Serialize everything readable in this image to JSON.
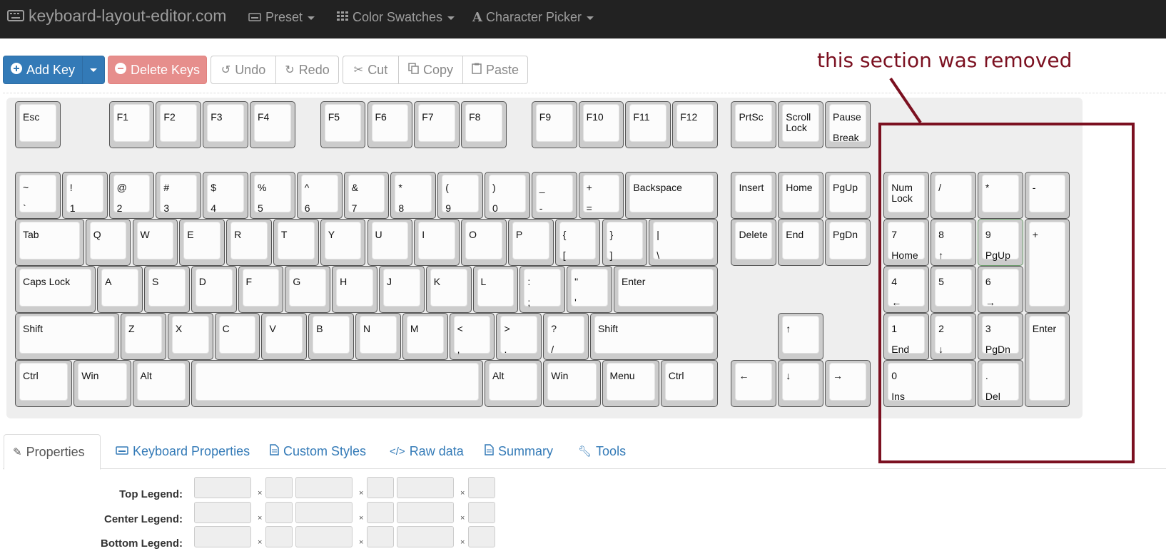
{
  "navbar": {
    "brand": "keyboard-layout-editor.com",
    "items": [
      {
        "icon": "keyboard-icon",
        "label": "Preset"
      },
      {
        "icon": "grid-icon",
        "label": "Color Swatches"
      },
      {
        "icon": "font-icon",
        "label": "Character Picker"
      }
    ]
  },
  "toolbar": {
    "add_key": "Add Key",
    "delete_keys": "Delete Keys",
    "undo": "Undo",
    "redo": "Redo",
    "cut": "Cut",
    "copy": "Copy",
    "paste": "Paste"
  },
  "keys": {
    "esc": {
      "top": "Esc"
    },
    "f1": {
      "top": "F1"
    },
    "f2": {
      "top": "F2"
    },
    "f3": {
      "top": "F3"
    },
    "f4": {
      "top": "F4"
    },
    "f5": {
      "top": "F5"
    },
    "f6": {
      "top": "F6"
    },
    "f7": {
      "top": "F7"
    },
    "f8": {
      "top": "F8"
    },
    "f9": {
      "top": "F9"
    },
    "f10": {
      "top": "F10"
    },
    "f11": {
      "top": "F11"
    },
    "f12": {
      "top": "F12"
    },
    "prtsc": {
      "top": "PrtSc"
    },
    "scrolllock": {
      "top": "Scroll\nLock"
    },
    "pause": {
      "top": "Pause",
      "bottom": "Break"
    },
    "grave": {
      "top": "~",
      "bottom": "`"
    },
    "n1": {
      "top": "!",
      "bottom": "1"
    },
    "n2": {
      "top": "@",
      "bottom": "2"
    },
    "n3": {
      "top": "#",
      "bottom": "3"
    },
    "n4": {
      "top": "$",
      "bottom": "4"
    },
    "n5": {
      "top": "%",
      "bottom": "5"
    },
    "n6": {
      "top": "^",
      "bottom": "6"
    },
    "n7": {
      "top": "&",
      "bottom": "7"
    },
    "n8": {
      "top": "*",
      "bottom": "8"
    },
    "n9": {
      "top": "(",
      "bottom": "9"
    },
    "n0": {
      "top": ")",
      "bottom": "0"
    },
    "minus": {
      "top": "_",
      "bottom": "-"
    },
    "equal": {
      "top": "+",
      "bottom": "="
    },
    "backspace": {
      "top": "Backspace"
    },
    "insert": {
      "top": "Insert"
    },
    "home": {
      "top": "Home"
    },
    "pgup": {
      "top": "PgUp"
    },
    "numlock": {
      "top": "Num\nLock"
    },
    "kpslash": {
      "top": "/"
    },
    "kpstar": {
      "top": "*"
    },
    "kpminus": {
      "top": "-"
    },
    "tab": {
      "top": "Tab"
    },
    "q": {
      "top": "Q"
    },
    "w": {
      "top": "W"
    },
    "e": {
      "top": "E"
    },
    "r": {
      "top": "R"
    },
    "t": {
      "top": "T"
    },
    "y": {
      "top": "Y"
    },
    "u": {
      "top": "U"
    },
    "i": {
      "top": "I"
    },
    "o": {
      "top": "O"
    },
    "p": {
      "top": "P"
    },
    "lbrace": {
      "top": "{",
      "bottom": "["
    },
    "rbrace": {
      "top": "}",
      "bottom": "]"
    },
    "pipe": {
      "top": "|",
      "bottom": "\\"
    },
    "delete": {
      "top": "Delete"
    },
    "end": {
      "top": "End"
    },
    "pgdn": {
      "top": "PgDn"
    },
    "kp7": {
      "top": "7",
      "bottom": "Home"
    },
    "kp8": {
      "top": "8",
      "bottom": "↑"
    },
    "kp9": {
      "top": "9",
      "bottom": "PgUp"
    },
    "kpplus": {
      "top": "+"
    },
    "caps": {
      "top": "Caps Lock"
    },
    "a": {
      "top": "A"
    },
    "s": {
      "top": "S"
    },
    "d": {
      "top": "D"
    },
    "f": {
      "top": "F"
    },
    "g": {
      "top": "G"
    },
    "h": {
      "top": "H"
    },
    "j": {
      "top": "J"
    },
    "k": {
      "top": "K"
    },
    "l": {
      "top": "L"
    },
    "semi": {
      "top": ":",
      "bottom": ";"
    },
    "quote": {
      "top": "\"",
      "bottom": "'"
    },
    "enter": {
      "top": "Enter"
    },
    "kp4": {
      "top": "4",
      "bottom": "←"
    },
    "kp5": {
      "top": "5"
    },
    "kp6": {
      "top": "6",
      "bottom": "→"
    },
    "lshift": {
      "top": "Shift"
    },
    "z": {
      "top": "Z"
    },
    "x": {
      "top": "X"
    },
    "c": {
      "top": "C"
    },
    "v": {
      "top": "V"
    },
    "b": {
      "top": "B"
    },
    "n": {
      "top": "N"
    },
    "m": {
      "top": "M"
    },
    "comma": {
      "top": "<",
      "bottom": ","
    },
    "period": {
      "top": ">",
      "bottom": "."
    },
    "slash": {
      "top": "?",
      "bottom": "/"
    },
    "rshift": {
      "top": "Shift"
    },
    "up": {
      "top": "↑"
    },
    "kp1": {
      "top": "1",
      "bottom": "End"
    },
    "kp2": {
      "top": "2",
      "bottom": "↓"
    },
    "kp3": {
      "top": "3",
      "bottom": "PgDn"
    },
    "kpenter": {
      "top": "Enter"
    },
    "lctrl": {
      "top": "Ctrl"
    },
    "lwin": {
      "top": "Win"
    },
    "lalt": {
      "top": "Alt"
    },
    "space": {
      "top": ""
    },
    "ralt": {
      "top": "Alt"
    },
    "rwin": {
      "top": "Win"
    },
    "menu": {
      "top": "Menu"
    },
    "rctrl": {
      "top": "Ctrl"
    },
    "left": {
      "top": "←"
    },
    "down": {
      "top": "↓"
    },
    "right": {
      "top": "→"
    },
    "kp0": {
      "top": "0",
      "bottom": "Ins"
    },
    "kpdot": {
      "top": ".",
      "bottom": "Del"
    }
  },
  "annotation": {
    "text": "this section was removed",
    "color": "#7b1020"
  },
  "tabs": [
    {
      "icon": "edit-icon",
      "label": "Properties"
    },
    {
      "icon": "keyboard-icon",
      "label": "Keyboard Properties"
    },
    {
      "icon": "file-icon",
      "label": "Custom Styles"
    },
    {
      "icon": "code-icon",
      "label": "Raw data"
    },
    {
      "icon": "file-icon",
      "label": "Summary"
    },
    {
      "icon": "wrench-icon",
      "label": "Tools"
    }
  ],
  "properties": {
    "top_legend": "Top Legend:",
    "center_legend": "Center Legend:",
    "bottom_legend": "Bottom Legend:",
    "times": "×"
  },
  "colors": {
    "navbar": "#222222",
    "primary": "#337ab7",
    "danger": "#d9534f",
    "annotation": "#7b1020"
  }
}
